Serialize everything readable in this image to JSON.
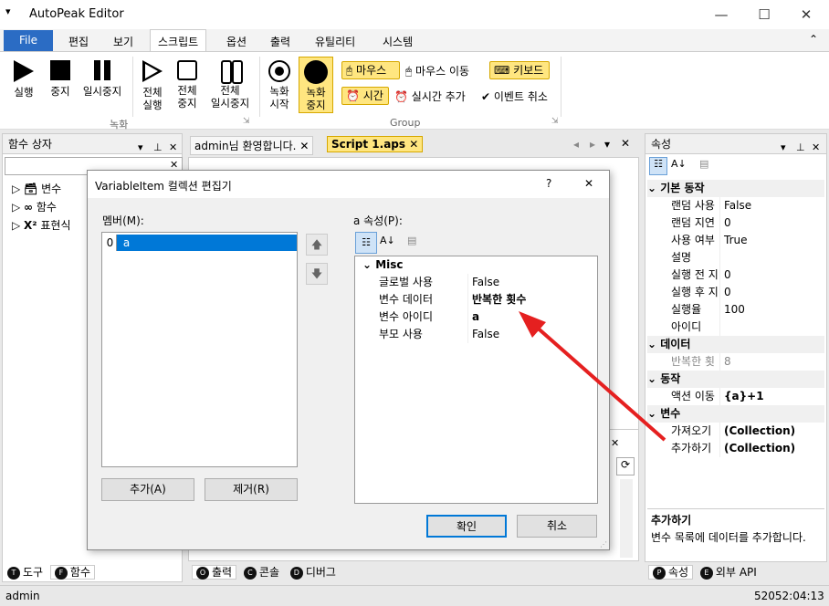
{
  "app": {
    "title": "AutoPeak Editor",
    "quick_access": "▾",
    "minimize": "—",
    "maximize": "☐",
    "close": "✕"
  },
  "menu": {
    "file": "File",
    "items": [
      "편집",
      "보기",
      "스크립트",
      "옵션",
      "출력",
      "유틸리티",
      "시스템"
    ],
    "collapse": "⌃"
  },
  "ribbon": {
    "run": "실행",
    "stop": "중지",
    "pause": "일시중지",
    "run_all": [
      "전체",
      "실행"
    ],
    "stop_all": [
      "전체",
      "중지"
    ],
    "pause_all": [
      "전체",
      "일시중지"
    ],
    "group_record": "녹화",
    "rec_start": [
      "녹화",
      "시작"
    ],
    "rec_stop": [
      "녹화",
      "중지"
    ],
    "mouse": "마우스",
    "mouse_move": "마우스 이동",
    "keyboard": "키보드",
    "time": "시간",
    "realtime_add": "실시간 추가",
    "event_cancel": "이벤트 취소",
    "group_group": "Group"
  },
  "left_panel": {
    "title": "함수 상자",
    "tree": [
      "변수",
      "함수",
      "표현식"
    ],
    "tabs": [
      "도구",
      "함수"
    ],
    "tab_icons": [
      "T",
      "F"
    ]
  },
  "doc_tabs": [
    "admin님 환영합니다.",
    "Script 1.aps"
  ],
  "bottom_tabs": [
    "출력",
    "콘솔",
    "디버그"
  ],
  "bottom_tab_icons": [
    "O",
    "C",
    "D"
  ],
  "right_panel": {
    "title": "속성",
    "categories": [
      {
        "name": "기본 동작",
        "rows": [
          [
            "랜덤 사용",
            "False"
          ],
          [
            "랜덤 지연",
            "0"
          ],
          [
            "사용 여부",
            "True"
          ],
          [
            "설명",
            ""
          ],
          [
            "실행 전 지",
            "0"
          ],
          [
            "실행 후 지",
            "0"
          ],
          [
            "실행율",
            "100"
          ],
          [
            "아이디",
            ""
          ]
        ]
      },
      {
        "name": "데이터",
        "rows": [
          [
            "반복한 횟",
            "8"
          ]
        ]
      },
      {
        "name": "동작",
        "rows": [
          [
            "액션 이동",
            "{a}+1"
          ]
        ]
      },
      {
        "name": "변수",
        "rows": [
          [
            "가져오기",
            "(Collection)"
          ],
          [
            "추가하기",
            "(Collection)"
          ]
        ]
      }
    ],
    "desc_title": "추가하기",
    "desc_text": "변수 목록에 데이터를 추가합니다.",
    "tabs": [
      "속성",
      "외부 API"
    ],
    "tab_icons": [
      "P",
      "E"
    ]
  },
  "dialog": {
    "title": "VariableItem 컬렉션 편집기",
    "help": "?",
    "close": "✕",
    "members_label": "멤버(M):",
    "members": [
      {
        "index": "0",
        "name": "a"
      }
    ],
    "props_label": "a 속성(P):",
    "category": "Misc",
    "props": [
      [
        "글로벌 사용",
        "False"
      ],
      [
        "변수 데이터",
        "반복한 횟수"
      ],
      [
        "변수 아이디",
        "a"
      ],
      [
        "부모 사용",
        "False"
      ]
    ],
    "add": "추가(A)",
    "remove": "제거(R)",
    "ok": "확인",
    "cancel": "취소"
  },
  "status": {
    "user": "admin",
    "time": "52052:04:13"
  },
  "colors": {
    "accent": "#2b6cc4",
    "highlight": "#ffe680",
    "arrow": "#e52020",
    "selection": "#0078d7"
  }
}
